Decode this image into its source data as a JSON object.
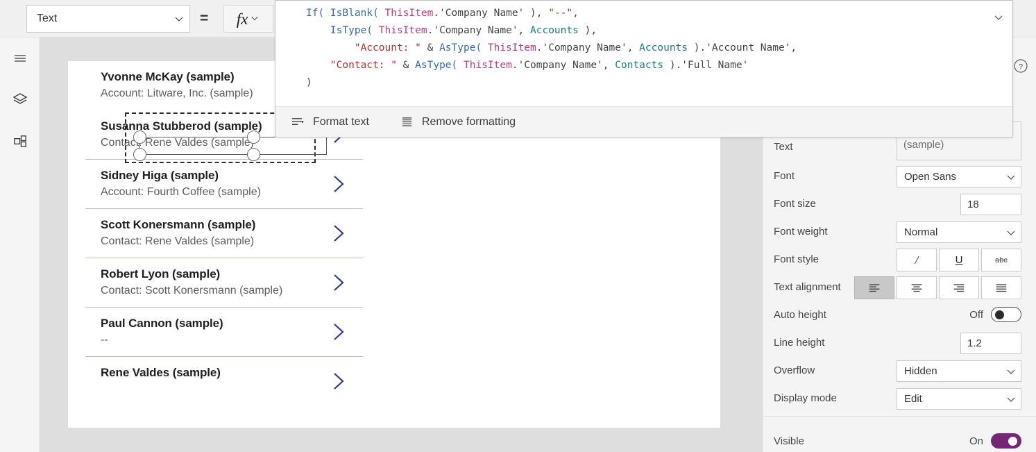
{
  "topbar": {
    "property_selector": {
      "value": "Text",
      "icon": "chevron-down-icon"
    },
    "equals": "=",
    "fx_button": {
      "glyph": "fx",
      "icon": "chevron-down-icon"
    }
  },
  "left_rail": {
    "items": [
      {
        "name": "hamburger-menu-icon",
        "label": "Menu"
      },
      {
        "name": "tree-view-icon",
        "label": "Tree view"
      },
      {
        "name": "insert-components-icon",
        "label": "Insert"
      }
    ]
  },
  "gallery": {
    "items": [
      {
        "title": "Yvonne McKay (sample)",
        "subtitle": "Account: Litware, Inc. (sample)",
        "selected": true
      },
      {
        "title": "Susanna Stubberod (sample)",
        "subtitle": "Contact: Rene Valdes (sample)",
        "selected": false
      },
      {
        "title": "Sidney Higa (sample)",
        "subtitle": "Account: Fourth Coffee (sample)",
        "selected": false
      },
      {
        "title": "Scott Konersmann (sample)",
        "subtitle": "Contact: Rene Valdes (sample)",
        "selected": false
      },
      {
        "title": "Robert Lyon (sample)",
        "subtitle": "Contact: Scott Konersmann (sample)",
        "selected": false
      },
      {
        "title": "Paul Cannon (sample)",
        "subtitle": "--",
        "selected": false
      },
      {
        "title": "Rene Valdes (sample)",
        "subtitle": "",
        "selected": false
      }
    ],
    "chevron_color": "#2b3a8f",
    "divider_color": "#b9bedb"
  },
  "formula": {
    "lines": [
      [
        {
          "t": "If( ",
          "c": "fn"
        },
        {
          "t": "IsBlank( ",
          "c": "fn"
        },
        {
          "t": "ThisItem",
          "c": "obj"
        },
        {
          "t": ".'Company Name' ), ",
          "c": "pln"
        },
        {
          "t": "\"--\"",
          "c": "str"
        },
        {
          "t": ",",
          "c": "pln"
        }
      ],
      [
        {
          "t": "    ",
          "c": "pln"
        },
        {
          "t": "IsType( ",
          "c": "fn"
        },
        {
          "t": "ThisItem",
          "c": "obj"
        },
        {
          "t": ".'Company Name', ",
          "c": "pln"
        },
        {
          "t": "Accounts",
          "c": "tbl"
        },
        {
          "t": " ),",
          "c": "pln"
        }
      ],
      [
        {
          "t": "        ",
          "c": "pln"
        },
        {
          "t": "\"Account: \"",
          "c": "str"
        },
        {
          "t": " & ",
          "c": "pln"
        },
        {
          "t": "AsType( ",
          "c": "fn"
        },
        {
          "t": "ThisItem",
          "c": "obj"
        },
        {
          "t": ".'Company Name', ",
          "c": "pln"
        },
        {
          "t": "Accounts",
          "c": "tbl"
        },
        {
          "t": " ).'Account Name',",
          "c": "pln"
        }
      ],
      [
        {
          "t": "    ",
          "c": "pln"
        },
        {
          "t": "\"Contact: \"",
          "c": "str"
        },
        {
          "t": " & ",
          "c": "pln"
        },
        {
          "t": "AsType( ",
          "c": "fn"
        },
        {
          "t": "ThisItem",
          "c": "obj"
        },
        {
          "t": ".'Company Name', ",
          "c": "pln"
        },
        {
          "t": "Contacts",
          "c": "tbl"
        },
        {
          "t": " ).'Full Name'",
          "c": "pln"
        }
      ],
      [
        {
          "t": ")",
          "c": "pln"
        }
      ]
    ],
    "collapse_icon": "chevron-down-icon",
    "footer": {
      "format_text": {
        "label": "Format text",
        "icon": "format-text-icon"
      },
      "remove_formatting": {
        "label": "Remove formatting",
        "icon": "remove-formatting-icon"
      }
    }
  },
  "properties_panel": {
    "rows": [
      {
        "label": "Text",
        "type": "multiline",
        "value": "Account: Litware, Inc. (sample)"
      },
      {
        "label": "Font",
        "type": "dropdown",
        "value": "Open Sans"
      },
      {
        "label": "Font size",
        "type": "textbox",
        "value": "18"
      },
      {
        "label": "Font weight",
        "type": "dropdown",
        "value": "Normal"
      },
      {
        "label": "Font style",
        "type": "style-buttons",
        "buttons": [
          {
            "name": "italic-button",
            "glyph": "/"
          },
          {
            "name": "underline-button",
            "glyph": "U"
          },
          {
            "name": "strikethrough-button",
            "glyph": "abc"
          }
        ]
      },
      {
        "label": "Text alignment",
        "type": "align-buttons",
        "active_index": 0,
        "buttons": [
          {
            "name": "align-left-button"
          },
          {
            "name": "align-center-button"
          },
          {
            "name": "align-right-button"
          },
          {
            "name": "align-justify-button"
          }
        ]
      },
      {
        "label": "Auto height",
        "type": "toggle",
        "value": "Off",
        "on": false
      },
      {
        "label": "Line height",
        "type": "textbox",
        "value": "1.2"
      },
      {
        "label": "Overflow",
        "type": "dropdown",
        "value": "Hidden"
      },
      {
        "label": "Display mode",
        "type": "dropdown",
        "value": "Edit"
      }
    ],
    "visible_row": {
      "label": "Visible",
      "value": "On",
      "on": true
    },
    "toggle_on_color": "#742774",
    "help_icon": "help-circle-icon"
  }
}
